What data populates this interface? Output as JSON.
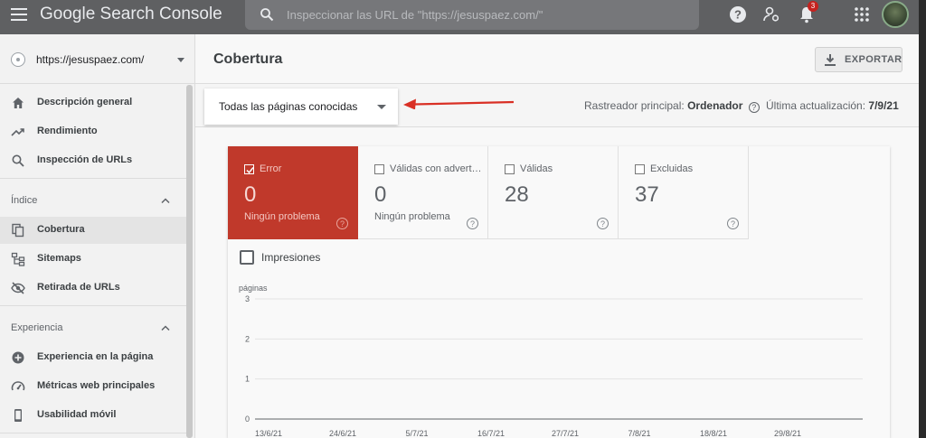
{
  "header": {
    "brand": "Google Search Console",
    "search_placeholder": "Inspeccionar las URL de \"https://jesuspaez.com/\"",
    "notification_count": "3"
  },
  "sidebar": {
    "property": "https://jesuspaez.com/",
    "top_items": [
      {
        "label": "Descripción general",
        "icon": "home-icon"
      },
      {
        "label": "Rendimiento",
        "icon": "trending-up-icon"
      },
      {
        "label": "Inspección de URLs",
        "icon": "search-icon"
      }
    ],
    "sections": [
      {
        "title": "Índice",
        "items": [
          {
            "label": "Cobertura",
            "icon": "file-copy-icon",
            "active": true
          },
          {
            "label": "Sitemaps",
            "icon": "sitemap-icon"
          },
          {
            "label": "Retirada de URLs",
            "icon": "eye-off-icon"
          }
        ]
      },
      {
        "title": "Experiencia",
        "items": [
          {
            "label": "Experiencia en la página",
            "icon": "add-circle-icon"
          },
          {
            "label": "Métricas web principales",
            "icon": "speed-icon"
          },
          {
            "label": "Usabilidad móvil",
            "icon": "phone-icon"
          }
        ]
      }
    ]
  },
  "main": {
    "title": "Cobertura",
    "export_label": "EXPORTAR",
    "filter_dropdown": "Todas las páginas conocidas",
    "crawler_label": "Rastreador principal:",
    "crawler_value": "Ordenador",
    "updated_label": "Última actualización:",
    "updated_value": "7/9/21"
  },
  "tiles": [
    {
      "label": "Error",
      "value": "0",
      "sub": "Ningún problema",
      "checked": true,
      "color": "#c0392b"
    },
    {
      "label": "Válidas con advertencias",
      "value": "0",
      "sub": "Ningún problema",
      "checked": false
    },
    {
      "label": "Válidas",
      "value": "28",
      "sub": "",
      "checked": false
    },
    {
      "label": "Excluidas",
      "value": "37",
      "sub": "",
      "checked": false
    }
  ],
  "impressions_label": "Impresiones",
  "chart_data": {
    "type": "line",
    "ylabel": "páginas",
    "ylim": [
      0,
      3
    ],
    "yticks": [
      "0",
      "1",
      "2",
      "3"
    ],
    "x": [
      "13/6/21",
      "24/6/21",
      "5/7/21",
      "16/7/21",
      "27/7/21",
      "7/8/21",
      "18/8/21",
      "29/8/21"
    ],
    "series": [],
    "grid": true
  },
  "colors": {
    "header_bg": "#5f6062",
    "error_tile": "#c0392b",
    "annotation_arrow": "#d93025"
  }
}
